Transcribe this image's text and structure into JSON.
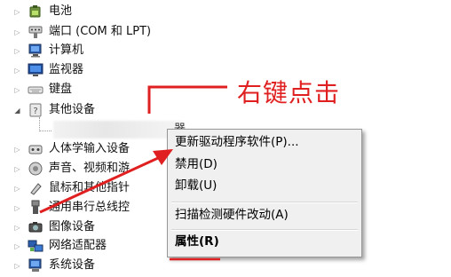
{
  "tree": {
    "items": [
      {
        "label": "电池",
        "expander": "▷",
        "icon": "battery-icon"
      },
      {
        "label": "端口 (COM 和 LPT)",
        "expander": "▷",
        "icon": "port-icon"
      },
      {
        "label": "计算机",
        "expander": "▷",
        "icon": "computer-icon"
      },
      {
        "label": "监视器",
        "expander": "▷",
        "icon": "monitor-icon"
      },
      {
        "label": "键盘",
        "expander": "▷",
        "icon": "keyboard-icon"
      },
      {
        "label": "其他设备",
        "expander": "◢",
        "icon": "other-devices-icon"
      },
      {
        "label": "人体学输入设备",
        "expander": "▷",
        "icon": "hid-icon"
      },
      {
        "label": "声音、视频和游",
        "expander": "▷",
        "icon": "sound-icon"
      },
      {
        "label": "鼠标和其他指针",
        "expander": "▷",
        "icon": "mouse-icon"
      },
      {
        "label": "通用串行总线控",
        "expander": "▷",
        "icon": "usb-icon"
      },
      {
        "label": "图像设备",
        "expander": "▷",
        "icon": "camera-icon"
      },
      {
        "label": "网络适配器",
        "expander": "▷",
        "icon": "network-icon"
      },
      {
        "label": "系统设备",
        "expander": "▷",
        "icon": "system-icon"
      }
    ],
    "blurred_child_tail": "器"
  },
  "context_menu": {
    "update_driver": "更新驱动程序软件(P)...",
    "disable": "禁用(D)",
    "uninstall": "卸载(U)",
    "scan": "扫描检测硬件改动(A)",
    "properties": "属性(R)"
  },
  "annotation": {
    "text": "右键点击",
    "color": "#e02020"
  }
}
